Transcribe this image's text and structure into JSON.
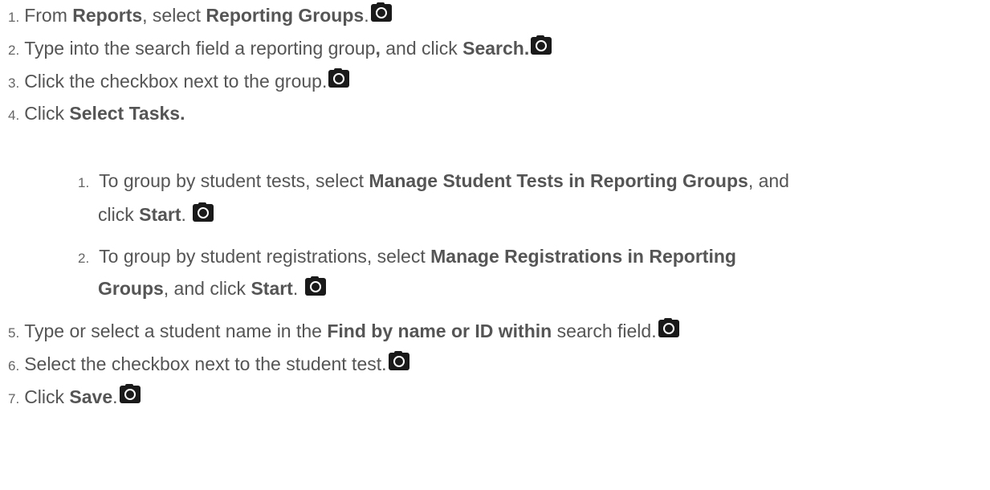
{
  "steps": [
    {
      "num": "1.",
      "parts": [
        [
          "t",
          "From "
        ],
        [
          "b",
          "Reports"
        ],
        [
          "t",
          ", select "
        ],
        [
          "b",
          "Reporting Groups"
        ],
        [
          "t",
          "."
        ]
      ]
    },
    {
      "num": "2.",
      "parts": [
        [
          "t",
          "Type into the search field a reporting group"
        ],
        [
          "b",
          ","
        ],
        [
          "t",
          " and click "
        ],
        [
          "b",
          "Search."
        ]
      ]
    },
    {
      "num": "3.",
      "parts": [
        [
          "t",
          "Click the checkbox next to the group."
        ]
      ]
    },
    {
      "num": "4.",
      "parts": [
        [
          "t",
          "Click "
        ],
        [
          "b",
          "Select Tasks."
        ]
      ]
    },
    {
      "num": "5.",
      "parts": [
        [
          "t",
          "Type or select a student name in the "
        ],
        [
          "b",
          "Find by name or ID within"
        ],
        [
          "t",
          " search field."
        ]
      ]
    },
    {
      "num": "6.",
      "parts": [
        [
          "t",
          "Select the checkbox next to the student test."
        ]
      ]
    },
    {
      "num": "7.",
      "parts": [
        [
          "t",
          "Click "
        ],
        [
          "b",
          "Save"
        ],
        [
          "t",
          "."
        ]
      ]
    }
  ],
  "substeps": [
    {
      "num": "1.",
      "line1": [
        [
          "t",
          "To group by student tests, select "
        ],
        [
          "b",
          "Manage Student Tests in Reporting Groups"
        ],
        [
          "t",
          ", and"
        ]
      ],
      "line2": [
        [
          "t",
          "click "
        ],
        [
          "b",
          "Start"
        ],
        [
          "t",
          "."
        ]
      ]
    },
    {
      "num": "2.",
      "line1": [
        [
          "t",
          "To group by student registrations, select "
        ],
        [
          "b",
          "Manage Registrations in Reporting"
        ]
      ],
      "line2": [
        [
          "b",
          "Groups"
        ],
        [
          "t",
          ", and click "
        ],
        [
          "b",
          "Start"
        ],
        [
          "t",
          "."
        ]
      ]
    }
  ],
  "icons": {
    "screenshot": "camera-icon"
  }
}
